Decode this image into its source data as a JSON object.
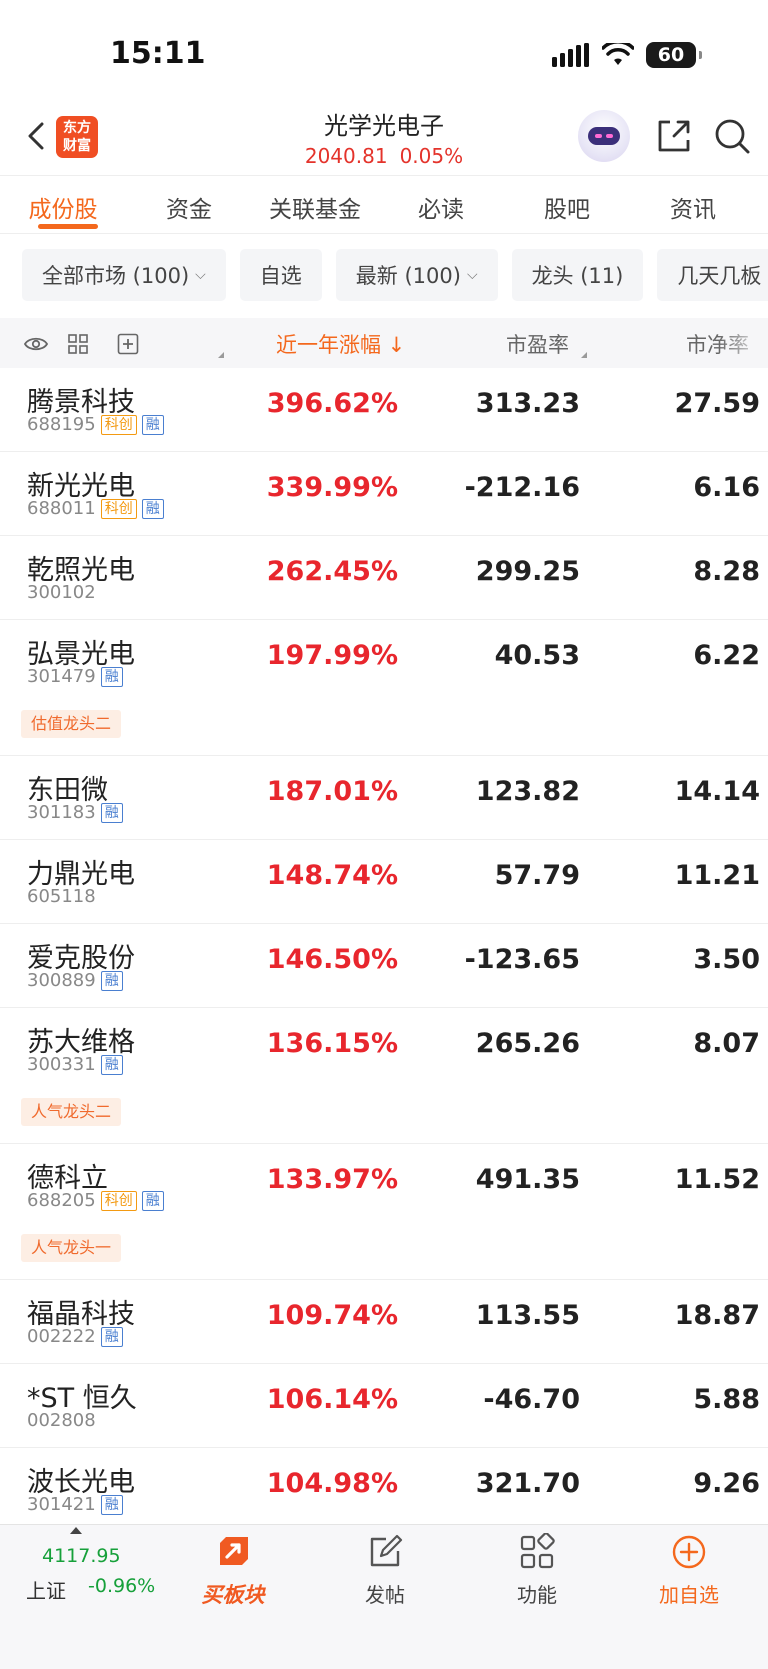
{
  "status": {
    "time": "15:11",
    "battery": "60"
  },
  "header": {
    "logo_line1": "东方",
    "logo_line2": "财富",
    "title": "光学光电子",
    "index_value": "2040.81",
    "index_change": "0.05%"
  },
  "tabs": [
    "成份股",
    "资金",
    "关联基金",
    "必读",
    "股吧",
    "资讯"
  ],
  "filters": [
    {
      "label": "全部市场 (100)",
      "dropdown": true
    },
    {
      "label": "自选",
      "dropdown": false
    },
    {
      "label": "最新 (100)",
      "dropdown": true
    },
    {
      "label": "龙头 (11)",
      "dropdown": false
    },
    {
      "label": "几天几板",
      "dropdown": false
    }
  ],
  "table": {
    "headers": {
      "change_1y": "近一年涨幅",
      "pe": "市盈率",
      "pb": "市净率"
    },
    "rows": [
      {
        "name": "腾景科技",
        "code": "688195",
        "tags": [
          "科创",
          "融"
        ],
        "leader": "",
        "change": "396.62%",
        "pe": "313.23",
        "pb": "27.59"
      },
      {
        "name": "新光光电",
        "code": "688011",
        "tags": [
          "科创",
          "融"
        ],
        "leader": "",
        "change": "339.99%",
        "pe": "-212.16",
        "pb": "6.16"
      },
      {
        "name": "乾照光电",
        "code": "300102",
        "tags": [],
        "leader": "",
        "change": "262.45%",
        "pe": "299.25",
        "pb": "8.28"
      },
      {
        "name": "弘景光电",
        "code": "301479",
        "tags": [
          "融"
        ],
        "leader": "估值龙头二",
        "change": "197.99%",
        "pe": "40.53",
        "pb": "6.22"
      },
      {
        "name": "东田微",
        "code": "301183",
        "tags": [
          "融"
        ],
        "leader": "",
        "change": "187.01%",
        "pe": "123.82",
        "pb": "14.14"
      },
      {
        "name": "力鼎光电",
        "code": "605118",
        "tags": [],
        "leader": "",
        "change": "148.74%",
        "pe": "57.79",
        "pb": "11.21"
      },
      {
        "name": "爱克股份",
        "code": "300889",
        "tags": [
          "融"
        ],
        "leader": "",
        "change": "146.50%",
        "pe": "-123.65",
        "pb": "3.50"
      },
      {
        "name": "苏大维格",
        "code": "300331",
        "tags": [
          "融"
        ],
        "leader": "人气龙头二",
        "change": "136.15%",
        "pe": "265.26",
        "pb": "8.07"
      },
      {
        "name": "德科立",
        "code": "688205",
        "tags": [
          "科创",
          "融"
        ],
        "leader": "人气龙头一",
        "change": "133.97%",
        "pe": "491.35",
        "pb": "11.52"
      },
      {
        "name": "福晶科技",
        "code": "002222",
        "tags": [
          "融"
        ],
        "leader": "",
        "change": "109.74%",
        "pe": "113.55",
        "pb": "18.87"
      },
      {
        "name": "*ST 恒久",
        "code": "002808",
        "tags": [],
        "leader": "",
        "change": "106.14%",
        "pe": "-46.70",
        "pb": "5.88"
      },
      {
        "name": "波长光电",
        "code": "301421",
        "tags": [
          "融"
        ],
        "leader": "",
        "change": "104.98%",
        "pe": "321.70",
        "pb": "9.26"
      }
    ]
  },
  "bottom": {
    "index_value": "4117.95",
    "index_name": "上证",
    "index_change": "-0.96%",
    "buy_sector": "买板块",
    "post": "发帖",
    "functions": "功能",
    "add_watch": "加自选"
  },
  "colors": {
    "accent": "#f4681d",
    "up": "#e8262d",
    "down": "#16a03a",
    "brand": "#f04e23"
  }
}
